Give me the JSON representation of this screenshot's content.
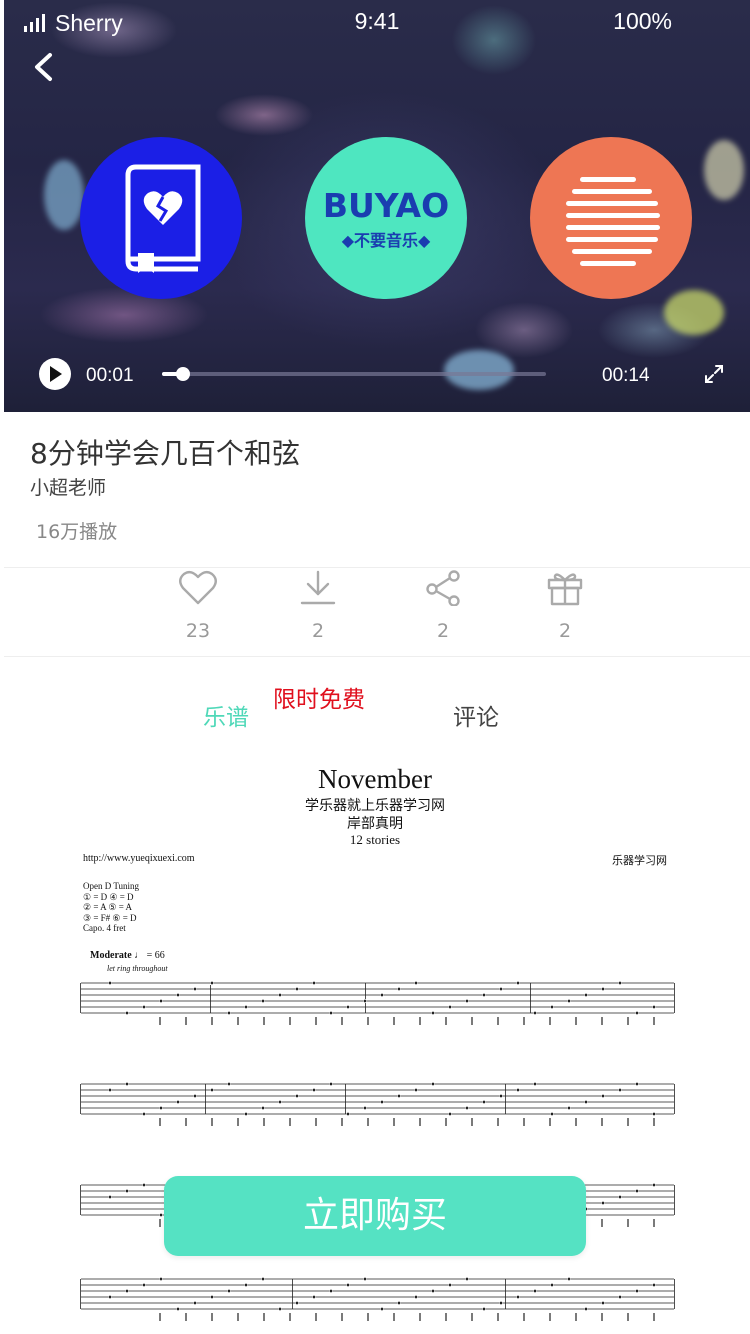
{
  "status_bar": {
    "carrier": "Sherry",
    "time": "9:41",
    "battery": "100%"
  },
  "player": {
    "current_time": "00:01",
    "total_time": "00:14",
    "progress": 0.055,
    "channel_icons": [
      "heartbreak-book-icon",
      "buyao-music-logo",
      "sound-lines-icon"
    ],
    "logo": {
      "main": "BUYAO",
      "sub": "◆不要音乐◆"
    }
  },
  "video": {
    "title": "8分钟学会几百个和弦",
    "author": "小超老师",
    "plays": "16万播放"
  },
  "actions": [
    {
      "icon": "heart-icon",
      "count": "23"
    },
    {
      "icon": "download-icon",
      "count": "2"
    },
    {
      "icon": "share-icon",
      "count": "2"
    },
    {
      "icon": "gift-icon",
      "count": "2"
    }
  ],
  "tabs": {
    "score": "乐谱",
    "badge": "限时免费",
    "comments": "评论"
  },
  "sheet": {
    "title": "November",
    "subtitle": "学乐器就上乐器学习网",
    "composer": "岸部真明",
    "album": "12 stories",
    "url": "http://www.yueqixuexi.com",
    "site": "乐器学习网",
    "tuning_lines": [
      "Open D Tuning",
      "① = D   ④ = D",
      "② = A   ⑤ = A",
      "③ = F#  ⑥ = D",
      "Capo. 4 fret"
    ],
    "tempo_label": "Moderate",
    "tempo_value": "♩ = 66",
    "let_ring": "let ring throughout"
  },
  "buy_button": "立即购买",
  "colors": {
    "accent": "#55e2c3",
    "tab_active": "#4fd8b8",
    "badge_red": "#e0101e"
  }
}
